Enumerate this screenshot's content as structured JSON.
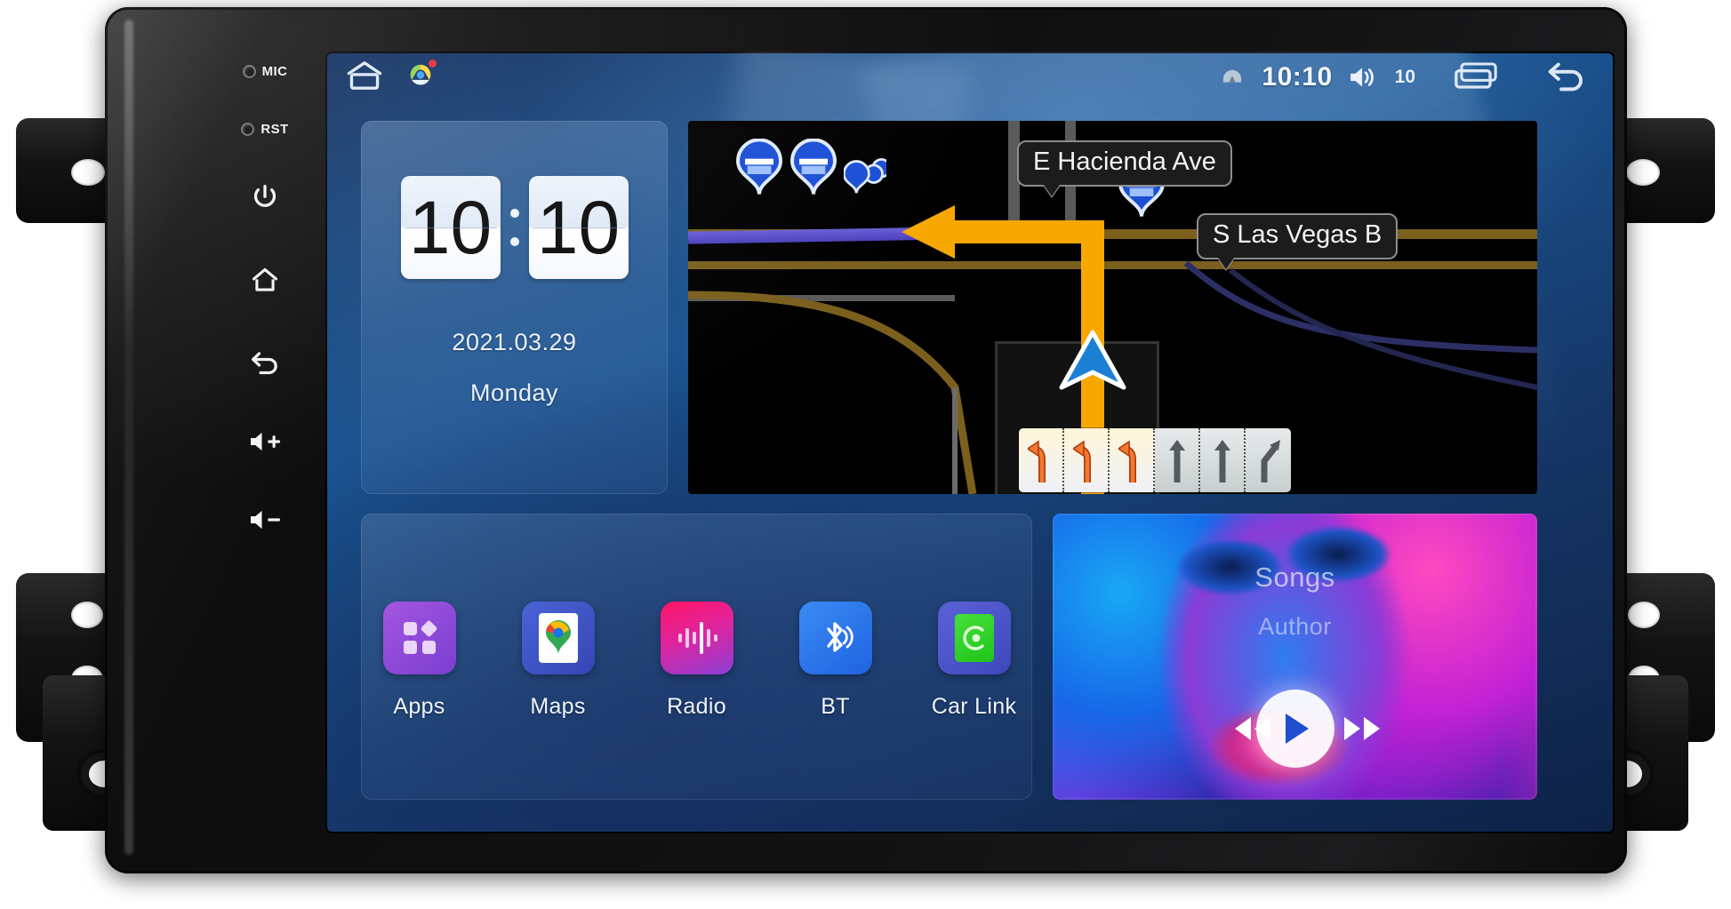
{
  "device": {
    "name": "Android Car Head Unit",
    "side_keys": [
      {
        "id": "mic",
        "icon": "microphone-led",
        "label": "MIC"
      },
      {
        "id": "reset",
        "icon": "reset-led",
        "label": "RST"
      },
      {
        "id": "power",
        "icon": "power-icon",
        "label": ""
      },
      {
        "id": "home",
        "icon": "home-icon",
        "label": ""
      },
      {
        "id": "back",
        "icon": "back-icon",
        "label": ""
      },
      {
        "id": "volume-up",
        "icon": "volume-up-icon",
        "label": ""
      },
      {
        "id": "volume-down",
        "icon": "volume-down-icon",
        "label": ""
      }
    ]
  },
  "status_bar": {
    "left_icons": [
      {
        "name": "home-icon",
        "label": "Home"
      },
      {
        "name": "play-store-icon",
        "label": "Play Store",
        "badge": true
      }
    ],
    "nav_icon": "navigation-icon",
    "clock": "10:10",
    "volume_icon": "volume-icon",
    "volume_level": "10",
    "recents_icon": "recents-icon",
    "back_icon": "back-icon"
  },
  "clock_widget": {
    "hours": "10",
    "minutes": "10",
    "date": "2021.03.29",
    "day": "Monday"
  },
  "map": {
    "street_labels": [
      {
        "name": "street-label-hacienda",
        "text": "E Hacienda Ave"
      },
      {
        "name": "street-label-las-vegas",
        "text": "S Las Vegas B"
      }
    ],
    "pins": [
      {
        "name": "poi-pin-1",
        "kind": "transit"
      },
      {
        "name": "poi-pin-2",
        "kind": "transit"
      },
      {
        "name": "poi-pin-3",
        "kind": "cluster"
      },
      {
        "name": "poi-pin-4",
        "kind": "transit"
      }
    ],
    "position_marker": "vehicle-arrow",
    "route_color": "#F7A800",
    "maneuver": "turn-left",
    "lanes": [
      {
        "direction": "left",
        "active": true
      },
      {
        "direction": "left",
        "active": true
      },
      {
        "direction": "left",
        "active": true
      },
      {
        "direction": "straight",
        "active": false
      },
      {
        "direction": "straight",
        "active": false
      },
      {
        "direction": "right",
        "active": false
      }
    ]
  },
  "app_dock": {
    "apps": [
      {
        "label": "Apps",
        "icon": "apps-grid-icon",
        "color": "#9b4fd4"
      },
      {
        "label": "Maps",
        "icon": "maps-pin-icon",
        "color": "#3b55c9"
      },
      {
        "label": "Radio",
        "icon": "radio-wave-icon",
        "color": "#e8186b"
      },
      {
        "label": "BT",
        "icon": "bluetooth-icon",
        "color": "#2a7ef0"
      },
      {
        "label": "Car Link",
        "icon": "car-link-icon",
        "color": "#4a53c8"
      }
    ]
  },
  "music_widget": {
    "title": "Songs",
    "author": "Author",
    "prev_icon": "previous-track-icon",
    "play_icon": "play-icon",
    "next_icon": "next-track-icon"
  }
}
